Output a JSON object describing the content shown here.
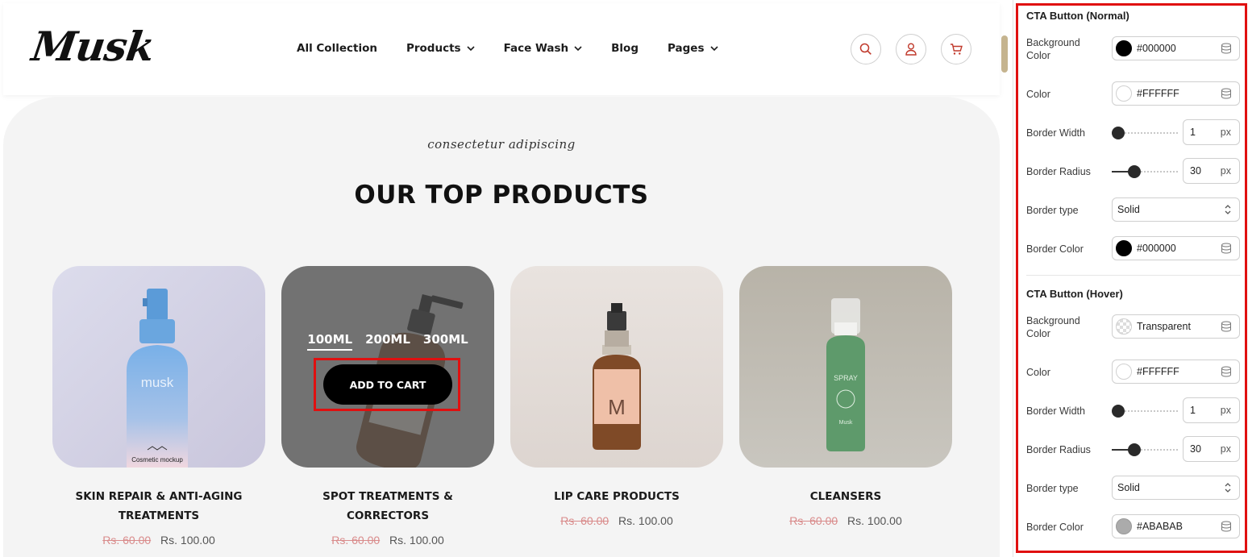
{
  "site": {
    "logo": "Musk",
    "nav": [
      {
        "label": "All Collection",
        "dropdown": false
      },
      {
        "label": "Products",
        "dropdown": true
      },
      {
        "label": "Face Wash",
        "dropdown": true
      },
      {
        "label": "Blog",
        "dropdown": false
      },
      {
        "label": "Pages",
        "dropdown": true
      }
    ],
    "header_icons": [
      "search-icon",
      "user-icon",
      "cart-icon"
    ]
  },
  "section": {
    "subtitle": "consectetur adipiscing",
    "title": "OUR TOP PRODUCTS"
  },
  "products": [
    {
      "name": "SKIN REPAIR & ANTI-AGING TREATMENTS",
      "old_price": "Rs. 60.00",
      "price": "Rs. 100.00",
      "bottle_label": "musk",
      "bottle_sublabel": "Cosmetic mockup"
    },
    {
      "name": "SPOT TREATMENTS & CORRECTORS",
      "old_price": "Rs. 60.00",
      "price": "Rs. 100.00",
      "sizes": [
        "100ML",
        "200ML",
        "300ML"
      ],
      "selected_size": "100ML",
      "cta": "ADD TO CART"
    },
    {
      "name": "LIP CARE PRODUCTS",
      "old_price": "Rs. 60.00",
      "price": "Rs. 100.00",
      "bottle_label": "M"
    },
    {
      "name": "CLEANSERS",
      "old_price": "Rs. 60.00",
      "price": "Rs. 100.00",
      "bottle_label": "SPRAY",
      "bottle_sublabel": "Musk"
    }
  ],
  "panel": {
    "normal": {
      "title": "CTA Button (Normal)",
      "background_color": {
        "label": "Background Color",
        "value": "#000000",
        "swatch": "#000000"
      },
      "color": {
        "label": "Color",
        "value": "#FFFFFF",
        "swatch": "#FFFFFF"
      },
      "border_width": {
        "label": "Border Width",
        "value": "1",
        "unit": "px",
        "slider_fraction": 0.0
      },
      "border_radius": {
        "label": "Border Radius",
        "value": "30",
        "unit": "px",
        "slider_fraction": 0.3
      },
      "border_type": {
        "label": "Border type",
        "value": "Solid"
      },
      "border_color": {
        "label": "Border Color",
        "value": "#000000",
        "swatch": "#000000"
      }
    },
    "hover": {
      "title": "CTA Button (Hover)",
      "background_color": {
        "label": "Background Color",
        "value": "Transparent",
        "swatch": "transparent"
      },
      "color": {
        "label": "Color",
        "value": "#FFFFFF",
        "swatch": "#FFFFFF"
      },
      "border_width": {
        "label": "Border Width",
        "value": "1",
        "unit": "px",
        "slider_fraction": 0.0
      },
      "border_radius": {
        "label": "Border Radius",
        "value": "30",
        "unit": "px",
        "slider_fraction": 0.3
      },
      "border_type": {
        "label": "Border type",
        "value": "Solid"
      },
      "border_color": {
        "label": "Border Color",
        "value": "#ABABAB",
        "swatch": "#ABABAB"
      }
    }
  },
  "colors": {
    "accent_red": "#e01010",
    "header_icon_red": "#c0392b",
    "scroll_thumb": "#c5b48f",
    "old_price": "#d98b8b"
  }
}
